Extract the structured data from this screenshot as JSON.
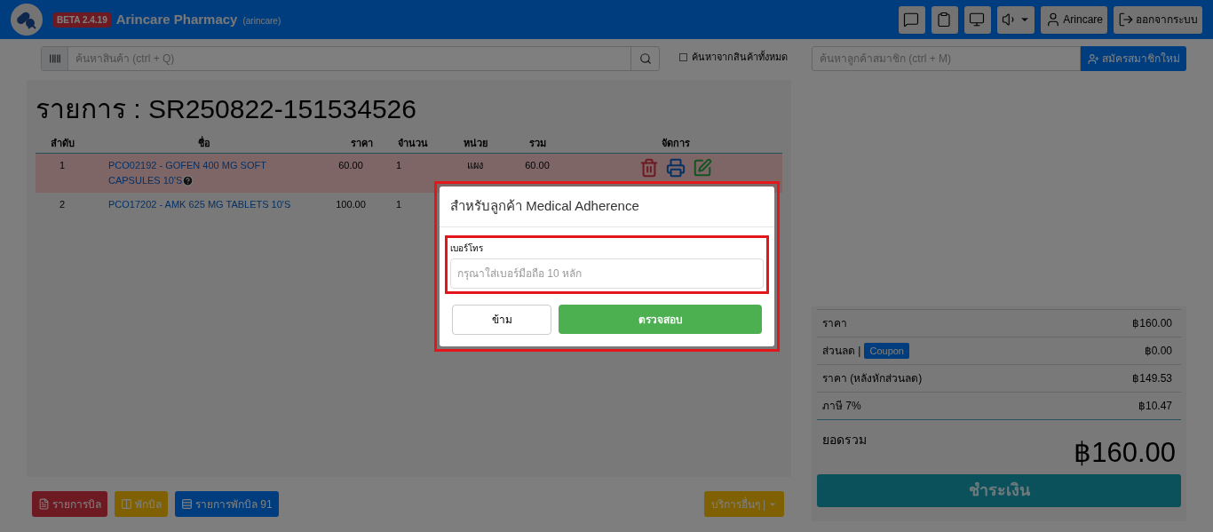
{
  "header": {
    "badge": "BETA 2.4.19",
    "title": "Arincare Pharmacy",
    "subtitle": "(arincare)",
    "buttons": [
      {
        "kind": "chat"
      },
      {
        "kind": "clipboard"
      },
      {
        "kind": "monitor"
      },
      {
        "kind": "sound"
      },
      {
        "kind": "user",
        "label": "Arincare"
      },
      {
        "kind": "logout",
        "label": "ออกจากระบบ"
      }
    ]
  },
  "product_search": {
    "placeholder": "ค้นหาสินค้า (ctrl + Q)",
    "all_products": {
      "label": "ค้นหาจากสินค้าทั้งหมด",
      "checked": false
    }
  },
  "member_search": {
    "placeholder": "ค้นหาลูกค้าสมาชิก (ctrl + M)",
    "register": "สมัครสมาชิกใหม่"
  },
  "bill": {
    "title": "รายการ : SR250822-151534526",
    "columns": [
      "ลำดับ",
      "ชื่อ",
      "ราคา",
      "จำนวน",
      "หน่วย",
      "รวม",
      "จัดการ"
    ],
    "rows": [
      {
        "no": "1",
        "name": "PCO02192 - GOFEN 400 MG SOFT CAPSULES 10'S",
        "help": true,
        "price": "60.00",
        "qty": "1",
        "unit": "แผง",
        "total": "60.00",
        "selected": true
      },
      {
        "no": "2",
        "name": "PCO17202 - AMK 625 MG TABLETS 10'S",
        "help": false,
        "price": "100.00",
        "qty": "1",
        "unit": "",
        "total": "",
        "selected": false
      }
    ]
  },
  "footer": {
    "buttons": [
      {
        "kind": "bills",
        "label": "รายการบิล"
      },
      {
        "kind": "hold",
        "label": "พักบิล"
      },
      {
        "kind": "held",
        "label": "รายการพักบิล 91"
      }
    ],
    "more": "บริการอื่นๆ |"
  },
  "summary": {
    "rows": [
      {
        "label": "ราคา",
        "value": "฿160.00"
      },
      {
        "label": "ส่วนลด |",
        "coupon": "Coupon",
        "value": "฿0.00"
      },
      {
        "label": "ราคา (หลังหักส่วนลด)",
        "value": "฿149.53"
      },
      {
        "label": "ภาษี 7%",
        "value": "฿10.47"
      }
    ],
    "total_label": "ยอดรวม",
    "total": "฿160.00",
    "pay": "ชำระเงิน"
  },
  "modal": {
    "title": "สำหรับลูกค้า Medical Adherence",
    "field_label": "เบอร์โทร",
    "placeholder": "กรุณาใส่เบอร์มือถือ 10 หลัก",
    "skip": "ข้าม",
    "check": "ตรวจสอบ"
  }
}
